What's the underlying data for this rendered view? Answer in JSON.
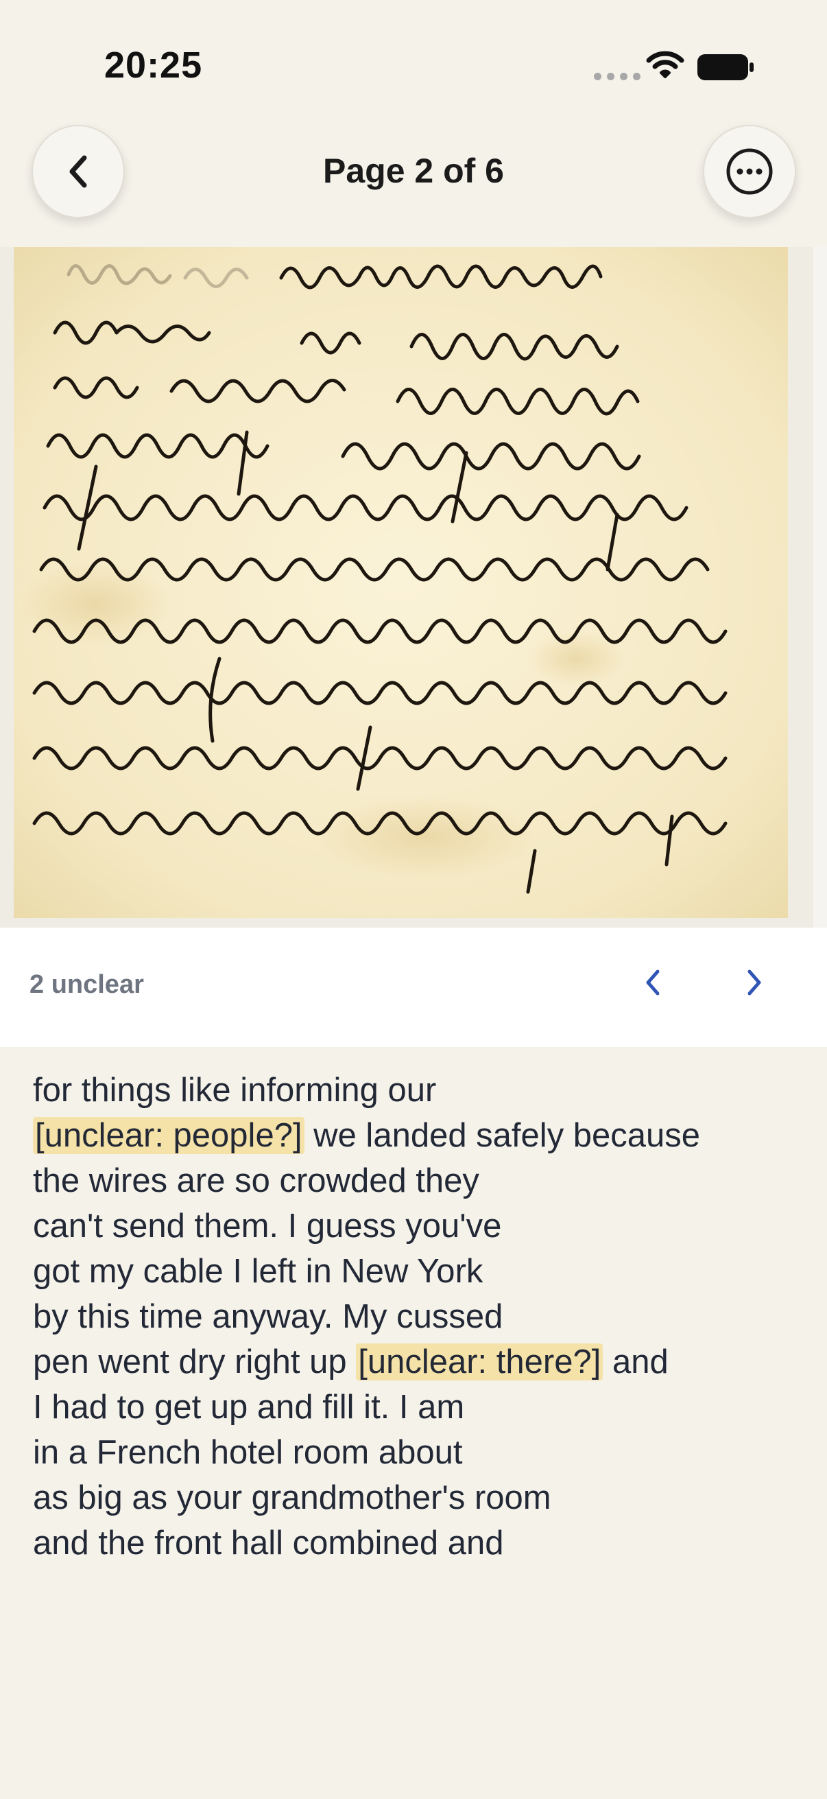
{
  "status_bar": {
    "time": "20:25"
  },
  "header": {
    "title": "Page 2 of 6"
  },
  "letter": {
    "image_alt": "handwritten letter"
  },
  "unclear_bar": {
    "count_label": "2 unclear"
  },
  "transcription": {
    "lines": [
      {
        "before": "for things like informing our",
        "tag": "",
        "after": ""
      },
      {
        "before": "",
        "tag": "[unclear: people?]",
        "after": " we landed safely because"
      },
      {
        "before": "the wires are so crowded they",
        "tag": "",
        "after": ""
      },
      {
        "before": "can't send them. I guess you've",
        "tag": "",
        "after": ""
      },
      {
        "before": "got my cable I left in New York",
        "tag": "",
        "after": ""
      },
      {
        "before": "by this time anyway. My cussed",
        "tag": "",
        "after": ""
      },
      {
        "before": "pen went dry right up ",
        "tag": "[unclear: there?]",
        "after": " and"
      },
      {
        "before": "I had to get up and fill it. I am",
        "tag": "",
        "after": ""
      },
      {
        "before": "in a French hotel room about",
        "tag": "",
        "after": ""
      },
      {
        "before": "as big as your grandmother's room",
        "tag": "",
        "after": ""
      },
      {
        "before": "and the front hall combined and",
        "tag": "",
        "after": ""
      }
    ]
  },
  "colors": {
    "background": "#f5f2ea",
    "accent": "#2f55b5",
    "unclear_highlight": "#f5e2a8",
    "paper": "#f6edcc",
    "ink": "#1a1510"
  },
  "icons": {
    "back": "chevron-left-icon",
    "more": "ellipsis-circle-icon",
    "prev_unclear": "chevron-left-icon",
    "next_unclear": "chevron-right-icon",
    "wifi": "wifi-icon",
    "battery": "battery-icon"
  }
}
